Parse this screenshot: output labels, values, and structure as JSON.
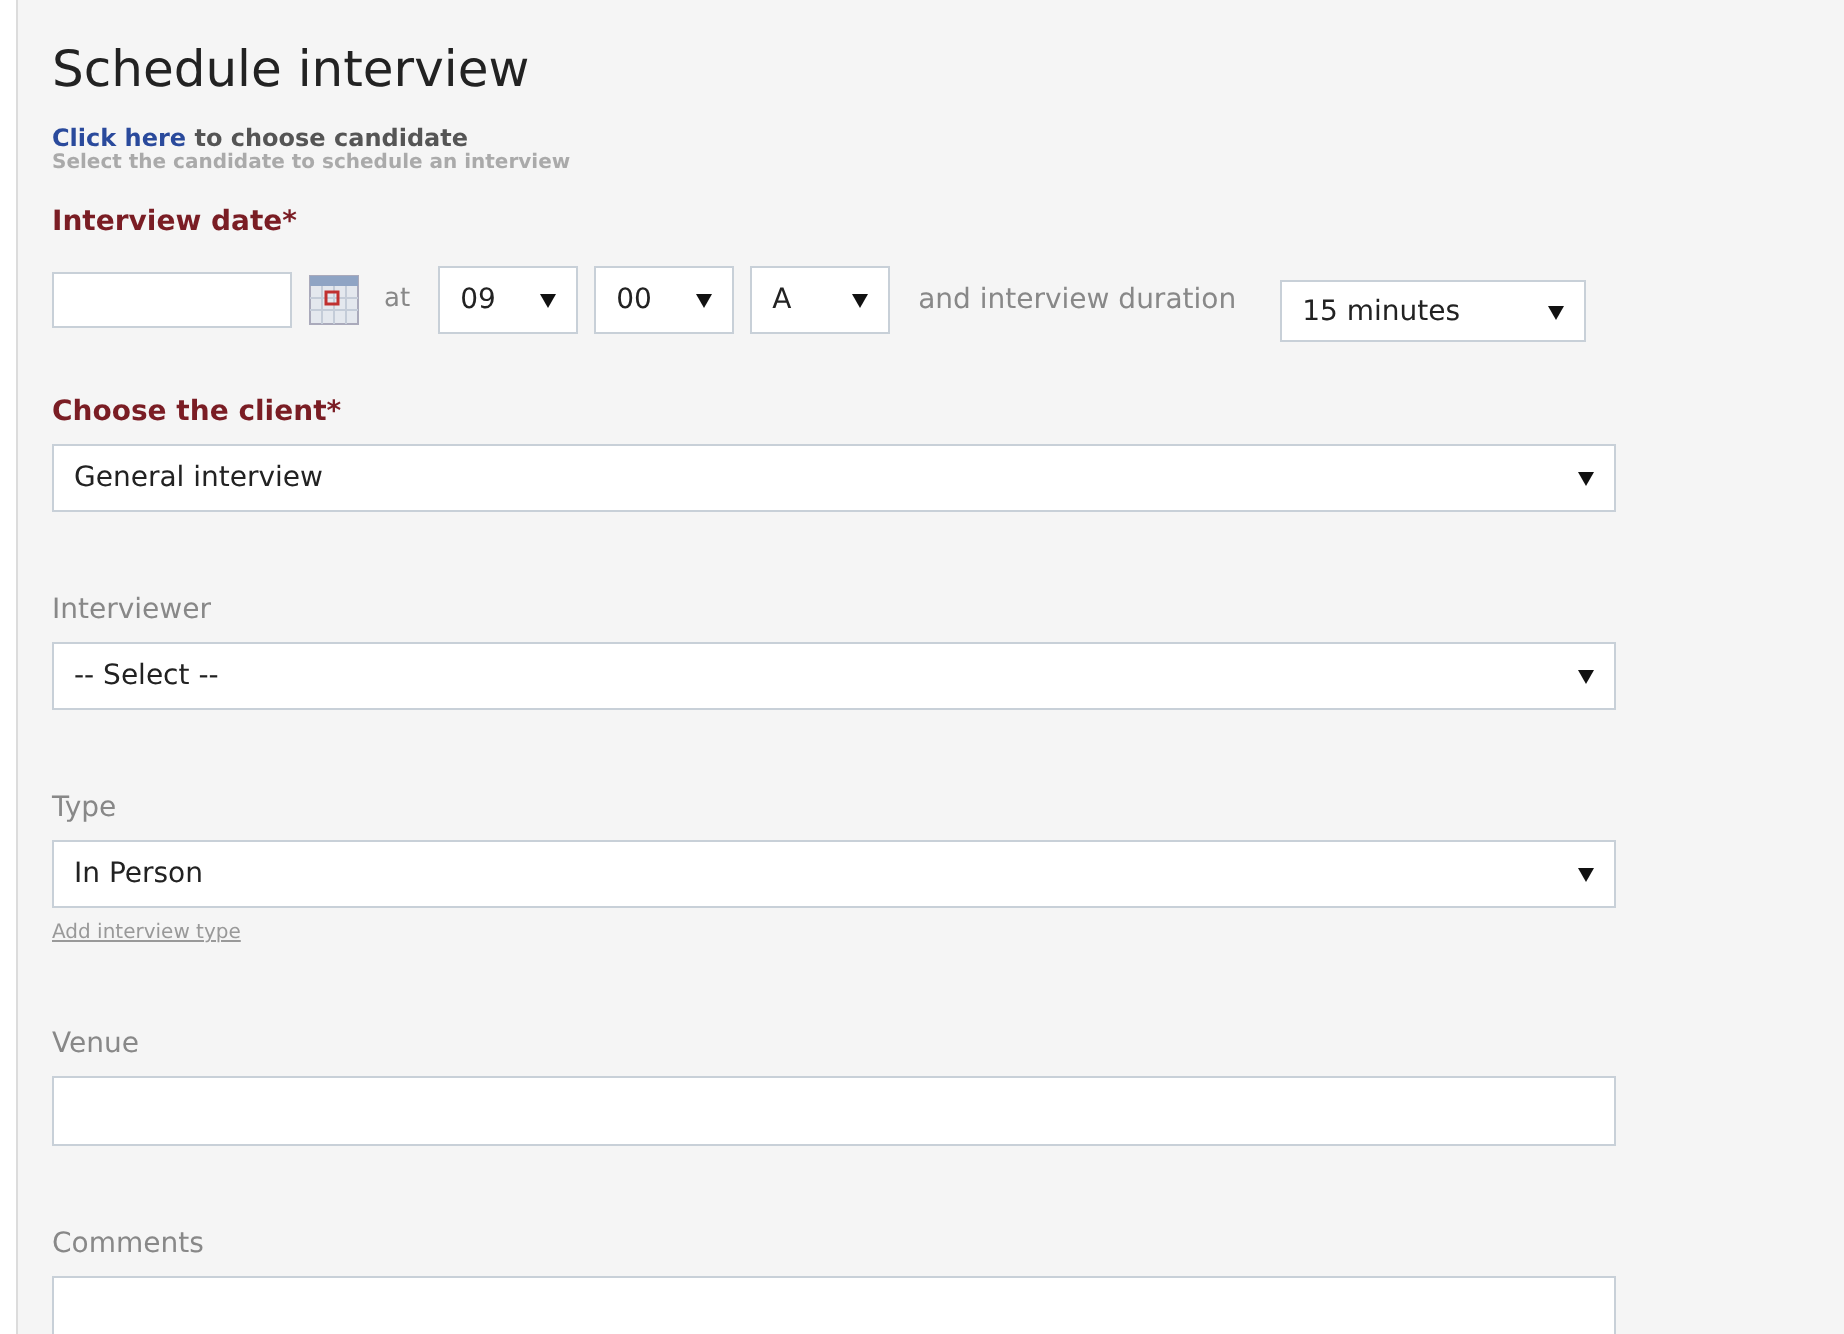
{
  "title": "Schedule interview",
  "candidate": {
    "link": "Click here",
    "text": "to choose candidate",
    "hint": "Select the candidate to schedule an interview"
  },
  "date": {
    "label": "Interview date*",
    "required": true,
    "at": "at",
    "time": [
      {
        "value": "09"
      },
      {
        "value": "00"
      },
      {
        "value": "A"
      }
    ],
    "duration_text": "and interview duration",
    "duration": "15 minutes"
  },
  "fields": [
    {
      "label": "Choose the client*",
      "required": true,
      "kind": "select",
      "value": "General interview"
    },
    {
      "label": "Interviewer",
      "required": false,
      "kind": "select",
      "value": "-- Select --"
    },
    {
      "label": "Type",
      "required": false,
      "kind": "select",
      "value": "In Person",
      "link": "Add interview type"
    },
    {
      "label": "Venue",
      "required": false,
      "kind": "text"
    },
    {
      "label": "Comments",
      "required": false,
      "kind": "textarea"
    }
  ]
}
